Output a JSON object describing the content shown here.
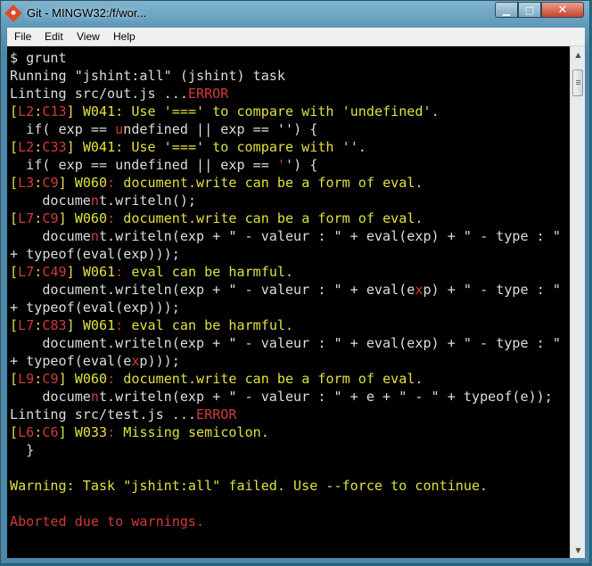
{
  "window": {
    "title": "Git - MINGW32:/f/wor...",
    "controls": {
      "minimize": "▁",
      "maximize": "□",
      "close": "✕"
    }
  },
  "menu": [
    "File",
    "Edit",
    "View",
    "Help"
  ],
  "colors": {
    "default": "#c6c6c6",
    "yellow": "#e0e040",
    "red": "#d23a3a"
  },
  "terminal": {
    "lines": [
      [
        {
          "t": "$ grunt",
          "c": "w"
        }
      ],
      [
        {
          "t": "Running \"jshint:all\" (jshint) task",
          "c": "w"
        }
      ],
      [
        {
          "t": "Linting src/out.js ...",
          "c": "w"
        },
        {
          "t": "ERROR",
          "c": "r"
        }
      ],
      [
        {
          "t": "[",
          "c": "y"
        },
        {
          "t": "L2",
          "c": "r"
        },
        {
          "t": ":",
          "c": "y"
        },
        {
          "t": "C13",
          "c": "r"
        },
        {
          "t": "] W041: Use '===' to compare with 'undefined'.",
          "c": "y"
        }
      ],
      [
        {
          "t": "  if( exp == ",
          "c": "w"
        },
        {
          "t": "u",
          "c": "r"
        },
        {
          "t": "ndefined || exp == '') {",
          "c": "w"
        }
      ],
      [
        {
          "t": "[",
          "c": "y"
        },
        {
          "t": "L2",
          "c": "r"
        },
        {
          "t": ":",
          "c": "y"
        },
        {
          "t": "C33",
          "c": "r"
        },
        {
          "t": "] W041: Use '===' to compare with ''.",
          "c": "y"
        }
      ],
      [
        {
          "t": "  if( exp == undefined || exp == ",
          "c": "w"
        },
        {
          "t": "'",
          "c": "r"
        },
        {
          "t": "') {",
          "c": "w"
        }
      ],
      [
        {
          "t": "[",
          "c": "y"
        },
        {
          "t": "L3",
          "c": "r"
        },
        {
          "t": ":",
          "c": "y"
        },
        {
          "t": "C9",
          "c": "r"
        },
        {
          "t": "] W060",
          "c": "y"
        },
        {
          "t": ":",
          "c": "r"
        },
        {
          "t": " document.write can be a form of eval.",
          "c": "y"
        }
      ],
      [
        {
          "t": "    docume",
          "c": "w"
        },
        {
          "t": "n",
          "c": "r"
        },
        {
          "t": "t.writeln();",
          "c": "w"
        }
      ],
      [
        {
          "t": "[",
          "c": "y"
        },
        {
          "t": "L7",
          "c": "r"
        },
        {
          "t": ":",
          "c": "y"
        },
        {
          "t": "C9",
          "c": "r"
        },
        {
          "t": "] W060",
          "c": "y"
        },
        {
          "t": ":",
          "c": "r"
        },
        {
          "t": " document.write can be a form of eval.",
          "c": "y"
        }
      ],
      [
        {
          "t": "    docume",
          "c": "w"
        },
        {
          "t": "n",
          "c": "r"
        },
        {
          "t": "t.writeln(exp + \" - valeur : \" + eval(exp) + \" - type : \"",
          "c": "w"
        }
      ],
      [
        {
          "t": "+ typeof(eval(exp)));",
          "c": "w"
        }
      ],
      [
        {
          "t": "[",
          "c": "y"
        },
        {
          "t": "L7",
          "c": "r"
        },
        {
          "t": ":",
          "c": "y"
        },
        {
          "t": "C49",
          "c": "r"
        },
        {
          "t": "] W061",
          "c": "y"
        },
        {
          "t": ":",
          "c": "r"
        },
        {
          "t": " eval can be harmful.",
          "c": "y"
        }
      ],
      [
        {
          "t": "    document.writeln(exp + \" - valeur : \" + eval(e",
          "c": "w"
        },
        {
          "t": "x",
          "c": "r"
        },
        {
          "t": "p) + \" - type : \"",
          "c": "w"
        }
      ],
      [
        {
          "t": "+ typeof(eval(exp)));",
          "c": "w"
        }
      ],
      [
        {
          "t": "[",
          "c": "y"
        },
        {
          "t": "L7",
          "c": "r"
        },
        {
          "t": ":",
          "c": "y"
        },
        {
          "t": "C83",
          "c": "r"
        },
        {
          "t": "] W061",
          "c": "y"
        },
        {
          "t": ":",
          "c": "r"
        },
        {
          "t": " eval can be harmful.",
          "c": "y"
        }
      ],
      [
        {
          "t": "    document.writeln(exp + \" - valeur : \" + eval(exp) + \" - type : \"",
          "c": "w"
        }
      ],
      [
        {
          "t": "+ typeof(eval(e",
          "c": "w"
        },
        {
          "t": "x",
          "c": "r"
        },
        {
          "t": "p)));",
          "c": "w"
        }
      ],
      [
        {
          "t": "[",
          "c": "y"
        },
        {
          "t": "L9",
          "c": "r"
        },
        {
          "t": ":",
          "c": "y"
        },
        {
          "t": "C9",
          "c": "r"
        },
        {
          "t": "] W060",
          "c": "y"
        },
        {
          "t": ":",
          "c": "r"
        },
        {
          "t": " document.write can be a form of eval.",
          "c": "y"
        }
      ],
      [
        {
          "t": "    docume",
          "c": "w"
        },
        {
          "t": "n",
          "c": "r"
        },
        {
          "t": "t.writeln(exp + \" - valeur : \" + e + \" - \" + typeof(e));",
          "c": "w"
        }
      ],
      [
        {
          "t": "Linting src/test.js ...",
          "c": "w"
        },
        {
          "t": "ERROR",
          "c": "r"
        }
      ],
      [
        {
          "t": "[",
          "c": "y"
        },
        {
          "t": "L6",
          "c": "r"
        },
        {
          "t": ":",
          "c": "y"
        },
        {
          "t": "C6",
          "c": "r"
        },
        {
          "t": "] W033",
          "c": "y"
        },
        {
          "t": ":",
          "c": "r"
        },
        {
          "t": " Missing semicolon.",
          "c": "y"
        }
      ],
      [
        {
          "t": "  }",
          "c": "w"
        }
      ],
      [
        {
          "t": "",
          "c": "w"
        }
      ],
      [
        {
          "t": "Warning: Task \"jshint:all\" failed. Use --force to continue.",
          "c": "y"
        }
      ],
      [
        {
          "t": "",
          "c": "w"
        }
      ],
      [
        {
          "t": "Aborted due to warnings.",
          "c": "r"
        }
      ]
    ]
  },
  "scrollbar": {
    "up_arrow": "▲",
    "down_arrow": "▼"
  }
}
